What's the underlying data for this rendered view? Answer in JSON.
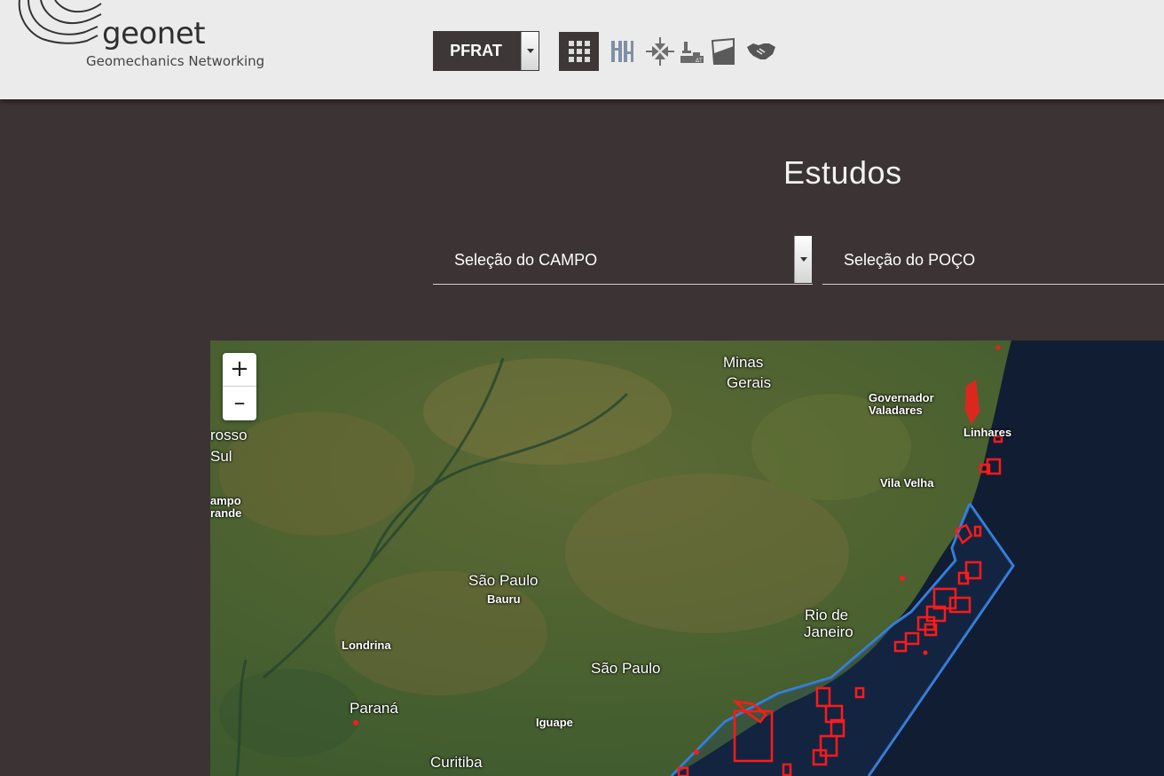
{
  "header": {
    "logo_word": "geonet",
    "logo_tagline": "Geomechanics Networking",
    "module_select": {
      "value": "PFRAT"
    },
    "tools": [
      {
        "icon": "grid-apps-icon"
      },
      {
        "icon": "well-casing-icon"
      },
      {
        "icon": "compression-arrows-icon"
      },
      {
        "icon": "lab-microscope-icon"
      },
      {
        "icon": "beaker-icon"
      },
      {
        "icon": "handshake-icon"
      }
    ]
  },
  "page": {
    "title": "Estudos"
  },
  "filters": {
    "campo": {
      "label": "Seleção do CAMPO"
    },
    "poco": {
      "label": "Seleção do POÇO"
    }
  },
  "map": {
    "zoom_in": "+",
    "zoom_out": "–",
    "labels": {
      "minas_gerais_1": "Minas",
      "minas_gerais_2": "Gerais",
      "governador_1": "Governador",
      "governador_2": "Valadares",
      "linhares": "Linhares",
      "vila_velha": "Vila Velha",
      "mato_grosso_1": "rosso",
      "mato_grosso_2": "Sul",
      "campo_grande_1": "ampo",
      "campo_grande_2": "rande",
      "sao_paulo_state": "São Paulo",
      "bauru": "Bauru",
      "rio_1": "Rio de",
      "rio_2": "Janeiro",
      "londrina": "Londrina",
      "sao_paulo_city": "São Paulo",
      "parana": "Paraná",
      "iguape": "Iguape",
      "curitiba": "Curitiba"
    },
    "colors": {
      "land": "#4b6231",
      "ocean": "#101c33",
      "basin_outline": "#3a86e6",
      "field_outline": "#ff1a1a"
    }
  }
}
